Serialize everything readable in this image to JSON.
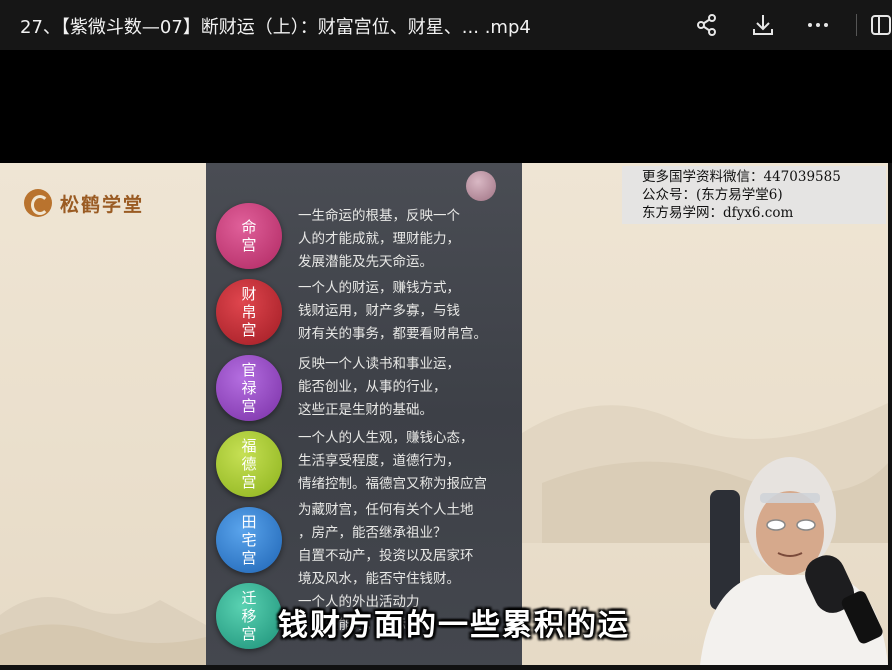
{
  "header": {
    "title": "27、【紫微斗数—07】断财运（上）：财富宫位、财星、...  .mp4"
  },
  "toolbar": {
    "share_icon": "share-icon",
    "download_icon": "download-icon",
    "more_icon": "more-icon"
  },
  "video": {
    "logo_text": "松鹤学堂",
    "watermark": {
      "line1": "更多国学资料微信：447039585",
      "line2": "公众号：(东方易学堂6)",
      "line3": "东方易学网：dfyx6.com"
    },
    "palaces": [
      {
        "name": "命宫",
        "color": "#c2356f",
        "desc": "一生命运的根基，反映一个\n人的才能成就，理财能力，\n发展潜能及先天命运。"
      },
      {
        "name": "财帛宫",
        "color": "#b0242c",
        "desc": "一个人的财运，赚钱方式，\n钱财运用，财产多寡，与钱\n财有关的事务，都要看财帛宫。"
      },
      {
        "name": "官禄宫",
        "color": "#8a3fb4",
        "desc": "反映一个人读书和事业运，\n能否创业，从事的行业，\n这些正是生财的基础。"
      },
      {
        "name": "福德宫",
        "color": "#9cc228",
        "desc": "一个人的人生观，赚钱心态，\n生活享受程度，道德行为，\n情绪控制。福德宫又称为报应宫"
      },
      {
        "name": "田宅宫",
        "color": "#2a78c8",
        "desc": "为藏财宫，任何有关个人土地\n，房产，能否继承祖业？\n自置不动产，投资以及居家环\n境及风水，能否守住钱财。"
      },
      {
        "name": "迁移宫",
        "color": "#2aa58a",
        "desc": "一个人的外出活动力\n，社交能力，人际关"
      }
    ],
    "subtitle": "钱财方面的一些累积的运"
  }
}
